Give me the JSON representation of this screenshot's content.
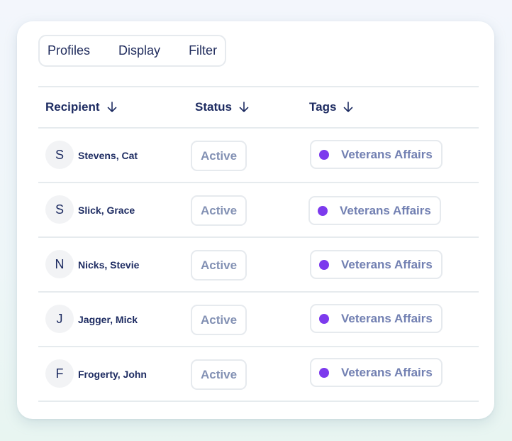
{
  "toolbar": {
    "items": [
      "Profiles",
      "Display",
      "Filter"
    ]
  },
  "table": {
    "columns": [
      {
        "label": "Recipient",
        "sort_icon": "arrow-down-icon"
      },
      {
        "label": "Status",
        "sort_icon": "arrow-down-icon"
      },
      {
        "label": "Tags",
        "sort_icon": "arrow-down-icon"
      }
    ],
    "rows": [
      {
        "initial": "S",
        "name": "Stevens, Cat",
        "status": "Active",
        "tag": "Veterans Affairs"
      },
      {
        "initial": "S",
        "name": "Slick, Grace",
        "status": "Active",
        "tag": "Veterans Affairs"
      },
      {
        "initial": "N",
        "name": "Nicks, Stevie",
        "status": "Active",
        "tag": "Veterans Affairs"
      },
      {
        "initial": "J",
        "name": "Jagger, Mick",
        "status": "Active",
        "tag": "Veterans Affairs"
      },
      {
        "initial": "F",
        "name": "Frogerty, John",
        "status": "Active",
        "tag": "Veterans Affairs"
      }
    ]
  },
  "colors": {
    "text_primary": "#1e2c62",
    "status_text": "#8391b4",
    "tag_text": "#7280b2",
    "tag_dot": "#7c3aed",
    "border": "#e6eaee"
  }
}
